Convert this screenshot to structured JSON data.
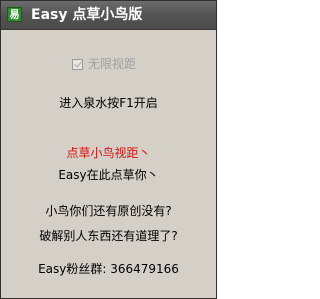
{
  "window": {
    "title": "Easy 点草小鸟版",
    "icon": "易"
  },
  "checkbox": {
    "label": "无限视距",
    "checked": false,
    "enabled": false
  },
  "lines": {
    "hint": "进入泉水按F1开启",
    "feature_name": "点草小鸟视距丶",
    "feature_sub": "Easy在此点草你丶",
    "question1": "小鸟你们还有原创没有?",
    "question2": "破解别人东西还有道理了?",
    "fans_group": "Easy粉丝群: 366479166"
  },
  "colors": {
    "window_bg": "#d4d0c8",
    "titlebar": "#555555",
    "title_text": "#ffffff",
    "accent_red": "#e01010",
    "disabled_text": "#a0a0a0"
  },
  "icons": {
    "app": "app-logo-icon",
    "checkbox": "checkbox-icon"
  }
}
